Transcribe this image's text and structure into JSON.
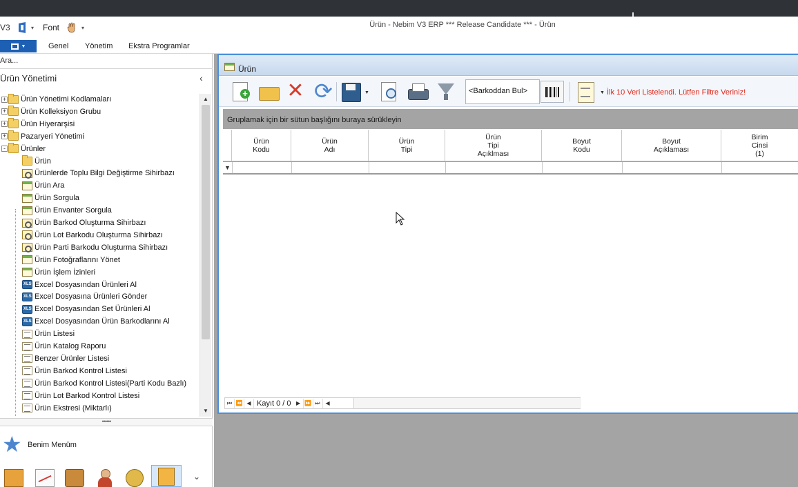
{
  "titlebar": {
    "logo": "V3",
    "font_label": "Font",
    "window_title": "Ürün - Nebim V3 ERP *** Release Candidate *** - Ürün"
  },
  "ribbon": {
    "tabs": [
      "Genel",
      "Yönetim",
      "Ekstra Programlar"
    ]
  },
  "left_panel": {
    "search_text": "Ara...",
    "title": "Ürün Yönetimi",
    "collapse_icon": "chevron-left-icon",
    "tree": [
      {
        "label": "Ürün Yönetimi Kodlamaları",
        "level": 0,
        "icon": "folder-icon",
        "expander": "+"
      },
      {
        "label": "Ürün Kolleksiyon Grubu",
        "level": 0,
        "icon": "folder-icon",
        "expander": "+"
      },
      {
        "label": "Ürün Hiyerarşisi",
        "level": 0,
        "icon": "folder-icon",
        "expander": "+"
      },
      {
        "label": "Pazaryeri Yönetimi",
        "level": 0,
        "icon": "folder-icon",
        "expander": "+"
      },
      {
        "label": "Ürünler",
        "level": 0,
        "icon": "folder-icon",
        "expander": "-"
      },
      {
        "label": "Ürün",
        "level": 1,
        "icon": "folder-icon"
      },
      {
        "label": "Ürünlerde Toplu Bilgi Değiştirme Sihirbazı",
        "level": 1,
        "icon": "wizard-icon"
      },
      {
        "label": "Ürün Ara",
        "level": 1,
        "icon": "form-icon"
      },
      {
        "label": "Ürün Sorgula",
        "level": 1,
        "icon": "form-icon"
      },
      {
        "label": "Ürün Envanter Sorgula",
        "level": 1,
        "icon": "form-icon"
      },
      {
        "label": "Ürün Barkod Oluşturma Sihirbazı",
        "level": 1,
        "icon": "wizard-icon"
      },
      {
        "label": "Ürün Lot Barkodu Oluşturma Sihirbazı",
        "level": 1,
        "icon": "wizard-icon"
      },
      {
        "label": "Ürün Parti Barkodu Oluşturma Sihirbazı",
        "level": 1,
        "icon": "wizard-icon"
      },
      {
        "label": "Ürün Fotoğraflarını Yönet",
        "level": 1,
        "icon": "form-icon"
      },
      {
        "label": "Ürün İşlem İzinleri",
        "level": 1,
        "icon": "form-icon"
      },
      {
        "label": "Excel Dosyasından Ürünleri Al",
        "level": 1,
        "icon": "excel-icon"
      },
      {
        "label": "Excel Dosyasına Ürünleri Gönder",
        "level": 1,
        "icon": "excel-icon"
      },
      {
        "label": "Excel Dosyasından Set Ürünleri Al",
        "level": 1,
        "icon": "excel-icon"
      },
      {
        "label": "Excel Dosyasından Ürün Barkodlarını Al",
        "level": 1,
        "icon": "excel-icon"
      },
      {
        "label": "Ürün Listesi",
        "level": 1,
        "icon": "list-icon"
      },
      {
        "label": "Ürün Katalog Raporu",
        "level": 1,
        "icon": "list-icon"
      },
      {
        "label": "Benzer Ürünler Listesi",
        "level": 1,
        "icon": "list-icon"
      },
      {
        "label": "Ürün Barkod Kontrol Listesi",
        "level": 1,
        "icon": "list-icon"
      },
      {
        "label": "Ürün Barkod Kontrol Listesi(Parti Kodu Bazlı)",
        "level": 1,
        "icon": "list-icon"
      },
      {
        "label": "Ürün Lot Barkod Kontrol Listesi",
        "level": 1,
        "icon": "list-icon"
      },
      {
        "label": "Ürün Ekstresi (Miktarlı)",
        "level": 1,
        "icon": "list-icon"
      }
    ],
    "favorites_label": "Benim Menüm",
    "bottom_icons": [
      "books-icon",
      "chart-icon",
      "briefcase-icon",
      "user-icon",
      "coins-icon",
      "product-icon"
    ]
  },
  "child_window": {
    "title": "Ürün",
    "barcode_placeholder": "<Barkoddan Bul>",
    "info_message": "İlk 10 Veri Listelendi. Lütfen Filtre Veriniz!",
    "group_panel_text": "Gruplamak için bir sütun başlığını buraya sürükleyin",
    "columns": [
      [
        "Ürün",
        "Kodu"
      ],
      [
        "Ürün",
        "Adı"
      ],
      [
        "Ürün",
        "Tipi"
      ],
      [
        "Ürün",
        "Tipi",
        "Açıklması"
      ],
      [
        "Boyut",
        "Kodu"
      ],
      [
        "Boyut",
        "Açıklaması"
      ],
      [
        "Birim",
        "Cinsi",
        "(1)"
      ]
    ],
    "navigator": {
      "record_text": "Kayıt 0 / 0"
    }
  },
  "colors": {
    "accent": "#4a90d9",
    "app_button": "#1c5fb3",
    "info_message": "#e0281b",
    "mdi_background": "#a4a4a4"
  }
}
